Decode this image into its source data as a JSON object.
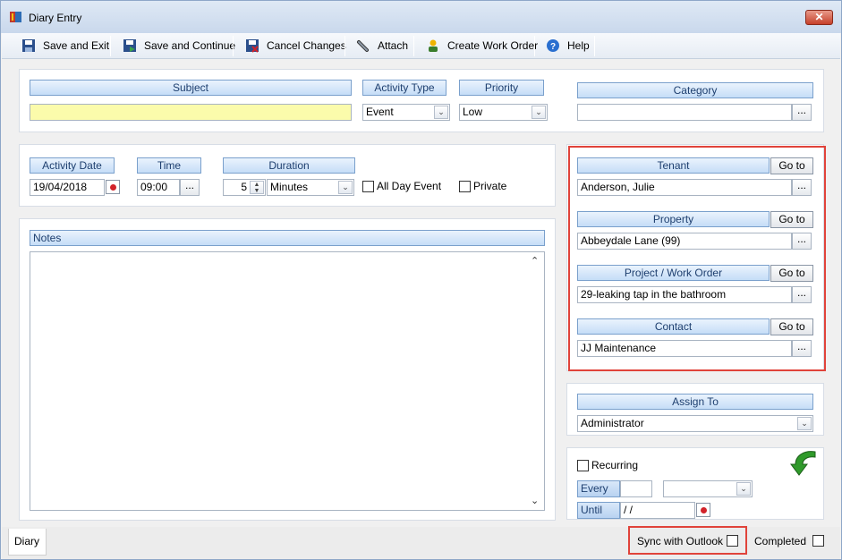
{
  "window": {
    "title": "Diary Entry",
    "close_label": "✕"
  },
  "toolbar": {
    "save_exit": "Save and Exit",
    "save_continue": "Save and Continue",
    "cancel_changes": "Cancel Changes",
    "attach": "Attach",
    "create_work_order": "Create Work Order",
    "help": "Help"
  },
  "top": {
    "subject_label": "Subject",
    "subject_value": "",
    "activity_type_label": "Activity Type",
    "activity_type_value": "Event",
    "priority_label": "Priority",
    "priority_value": "Low",
    "category_label": "Category",
    "category_value": ""
  },
  "datetime": {
    "activity_date_label": "Activity Date",
    "activity_date_value": "19/04/2018",
    "time_label": "Time",
    "time_value": "09:00",
    "duration_label": "Duration",
    "duration_value": "5",
    "duration_unit": "Minutes",
    "all_day_label": "All Day Event",
    "private_label": "Private"
  },
  "notes": {
    "label": "Notes",
    "value": ""
  },
  "links": {
    "tenant_label": "Tenant",
    "tenant_value": "Anderson, Julie",
    "property_label": "Property",
    "property_value": "Abbeydale Lane (99)",
    "project_label": "Project / Work Order",
    "project_value": "29-leaking tap in the bathroom",
    "contact_label": "Contact",
    "contact_value": "JJ Maintenance",
    "goto_label": "Go to",
    "ellipsis": "..."
  },
  "assign": {
    "label": "Assign To",
    "value": "Administrator"
  },
  "recurring": {
    "label": "Recurring",
    "every_label": "Every",
    "every_value": "",
    "every_unit": "",
    "until_label": "Until",
    "until_value": " / /"
  },
  "status": {
    "tab_diary": "Diary",
    "sync_label": "Sync with Outlook",
    "completed_label": "Completed"
  },
  "colors": {
    "highlight_red": "#e0433a",
    "subject_bg": "#fbfbab",
    "header_blue": "#c5ddf7"
  }
}
